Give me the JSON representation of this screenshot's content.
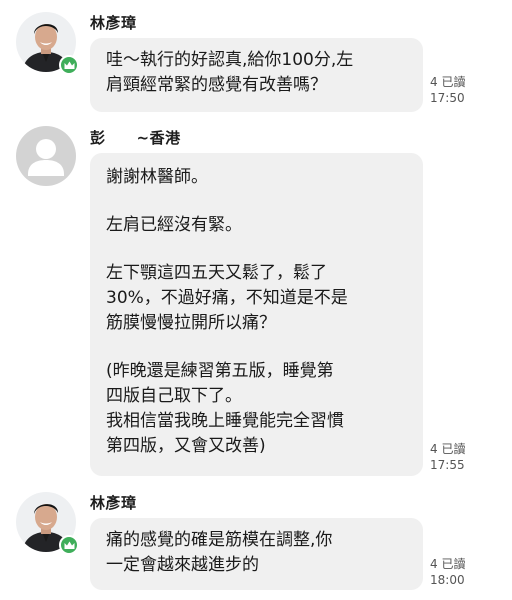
{
  "messages": [
    {
      "sender": "林彥璋",
      "avatar_icon": "doctor-photo-avatar",
      "badge_icon": "official-crown-badge",
      "lines": [
        "哇～執行的好認真,給你100分,左",
        "肩頸經常緊的感覺有改善嗎？"
      ],
      "read_receipt": "4 已讀",
      "time": "17:50"
    },
    {
      "sender": "彭　　~香港",
      "avatar_icon": "default-user-avatar",
      "paragraphs": [
        [
          "謝謝林醫師。"
        ],
        [
          "左肩已經沒有緊。"
        ],
        [
          "左下顎這四五天又鬆了，鬆了",
          "30%，不過好痛，不知道是不是",
          "筋膜慢慢拉開所以痛？"
        ],
        [
          "(昨晚還是練習第五版，睡覺第",
          "四版自己取下了。",
          "我相信當我晚上睡覺能完全習慣",
          "第四版，又會又改善)"
        ]
      ],
      "read_receipt": "4 已讀",
      "time": "17:55"
    },
    {
      "sender": "林彥璋",
      "avatar_icon": "doctor-photo-avatar",
      "badge_icon": "official-crown-badge",
      "lines": [
        "痛的感覺的確是筋模在調整,你",
        "一定會越來越進步的"
      ],
      "read_receipt": "4 已讀",
      "time": "18:00"
    }
  ],
  "colors": {
    "bubble": "#f0f0f0",
    "badge": "#3fae5a",
    "meta_text": "#555555"
  }
}
